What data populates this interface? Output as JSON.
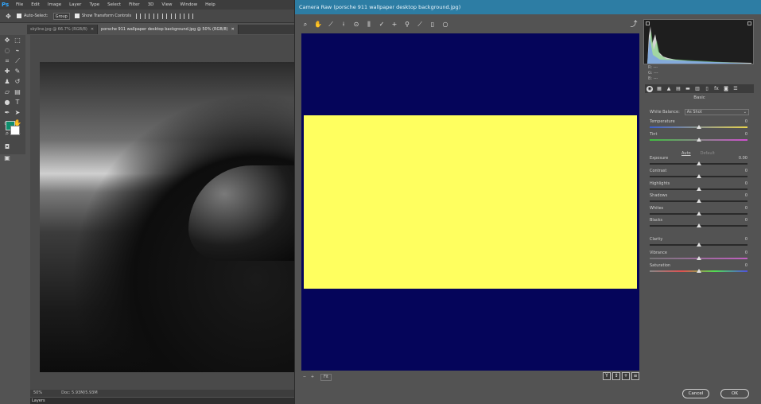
{
  "photoshop": {
    "logo": "Ps",
    "menu": [
      "File",
      "Edit",
      "Image",
      "Layer",
      "Type",
      "Select",
      "Filter",
      "3D",
      "View",
      "Window",
      "Help"
    ],
    "options": {
      "auto_select_label": "Auto-Select:",
      "group_value": "Group",
      "show_transform_label": "Show Transform Controls"
    },
    "tabs": [
      {
        "label": "skyline.jpg @ 66.7% (RGB/8)",
        "active": false
      },
      {
        "label": "porsche 911 wallpaper desktop background.jpg @ 50% (RGB/8)",
        "active": true
      }
    ],
    "status": {
      "zoom": "50%",
      "doc": "Doc: 5.93M/5.93M"
    },
    "layers_panel_title": "Layers",
    "foreground_color": "#0f8f6e",
    "background_color": "#ffffff"
  },
  "camera_raw": {
    "title": "Camera Raw (porsche 911 wallpaper desktop background.jpg)",
    "tools": [
      "zoom-icon",
      "hand-icon",
      "white-balance-icon",
      "color-sampler-icon",
      "targeted-adjustment-icon",
      "straighten-icon",
      "spot-removal-icon",
      "red-eye-icon",
      "adjustment-brush-icon",
      "graduated-filter-icon",
      "radial-filter-icon",
      "rotate-icon"
    ],
    "preview_colors": {
      "background": "#05055a",
      "overlay": "#ffff5f"
    },
    "zoom_value": "Fit",
    "view_buttons": [
      "Y",
      "↕",
      "+",
      "≡"
    ],
    "histogram_info": [
      "R: ---",
      "G: ---",
      "B: ---"
    ],
    "panel_name": "Basic",
    "white_balance": {
      "label": "White Balance:",
      "value": "As Shot"
    },
    "auto_label": "Auto",
    "default_label": "Default",
    "sliders": [
      {
        "label": "Temperature",
        "value": "0",
        "pos": 0.5,
        "track": "temp"
      },
      {
        "label": "Tint",
        "value": "0",
        "pos": 0.5,
        "track": "tint"
      },
      {
        "label": "Exposure",
        "value": "0.00",
        "pos": 0.5,
        "track": ""
      },
      {
        "label": "Contrast",
        "value": "0",
        "pos": 0.5,
        "track": ""
      },
      {
        "label": "Highlights",
        "value": "0",
        "pos": 0.5,
        "track": ""
      },
      {
        "label": "Shadows",
        "value": "0",
        "pos": 0.5,
        "track": ""
      },
      {
        "label": "Whites",
        "value": "0",
        "pos": 0.5,
        "track": ""
      },
      {
        "label": "Blacks",
        "value": "0",
        "pos": 0.5,
        "track": ""
      },
      {
        "label": "Clarity",
        "value": "0",
        "pos": 0.5,
        "track": ""
      },
      {
        "label": "Vibrance",
        "value": "0",
        "pos": 0.5,
        "track": "vib"
      },
      {
        "label": "Saturation",
        "value": "0",
        "pos": 0.5,
        "track": "sat"
      }
    ],
    "cancel_label": "Cancel",
    "ok_label": "OK"
  }
}
